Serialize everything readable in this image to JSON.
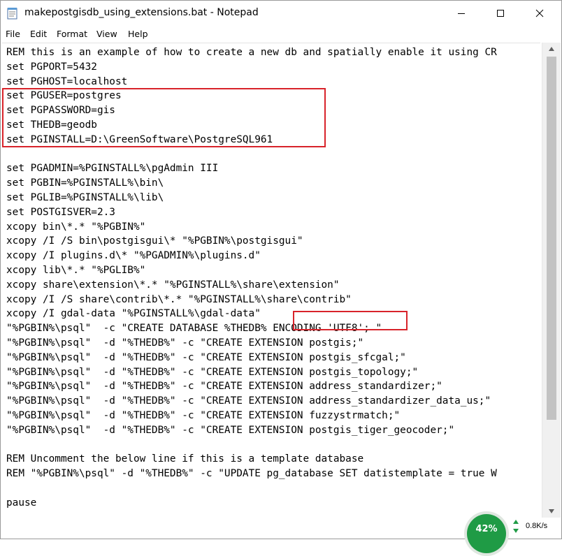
{
  "window": {
    "title": "makepostgisdb_using_extensions.bat - Notepad"
  },
  "menu": [
    "File",
    "Edit",
    "Format",
    "View",
    "Help"
  ],
  "editor": {
    "lines": [
      "REM this is an example of how to create a new db and spatially enable it using CR",
      "set PGPORT=5432",
      "set PGHOST=localhost",
      "set PGUSER=postgres",
      "set PGPASSWORD=gis",
      "set THEDB=geodb",
      "set PGINSTALL=D:\\GreenSoftware\\PostgreSQL961",
      "",
      "set PGADMIN=%PGINSTALL%\\pgAdmin III",
      "set PGBIN=%PGINSTALL%\\bin\\",
      "set PGLIB=%PGINSTALL%\\lib\\",
      "set POSTGISVER=2.3",
      "xcopy bin\\*.* \"%PGBIN%\"",
      "xcopy /I /S bin\\postgisgui\\* \"%PGBIN%\\postgisgui\"",
      "xcopy /I plugins.d\\* \"%PGADMIN%\\plugins.d\"",
      "xcopy lib\\*.* \"%PGLIB%\"",
      "xcopy share\\extension\\*.* \"%PGINSTALL%\\share\\extension\"",
      "xcopy /I /S share\\contrib\\*.* \"%PGINSTALL%\\share\\contrib\"",
      "xcopy /I gdal-data \"%PGINSTALL%\\gdal-data\"",
      "\"%PGBIN%\\psql\"  -c \"CREATE DATABASE %THEDB% ENCODING 'UTF8'; \"",
      "\"%PGBIN%\\psql\"  -d \"%THEDB%\" -c \"CREATE EXTENSION postgis;\"",
      "\"%PGBIN%\\psql\"  -d \"%THEDB%\" -c \"CREATE EXTENSION postgis_sfcgal;\"",
      "\"%PGBIN%\\psql\"  -d \"%THEDB%\" -c \"CREATE EXTENSION postgis_topology;\"",
      "\"%PGBIN%\\psql\"  -d \"%THEDB%\" -c \"CREATE EXTENSION address_standardizer;\"",
      "\"%PGBIN%\\psql\"  -d \"%THEDB%\" -c \"CREATE EXTENSION address_standardizer_data_us;\"",
      "\"%PGBIN%\\psql\"  -d \"%THEDB%\" -c \"CREATE EXTENSION fuzzystrmatch;\"",
      "\"%PGBIN%\\psql\"  -d \"%THEDB%\" -c \"CREATE EXTENSION postgis_tiger_geocoder;\"",
      "",
      "REM Uncomment the below line if this is a template database",
      "REM \"%PGBIN%\\psql\" -d \"%THEDB%\" -c \"UPDATE pg_database SET datistemplate = true W",
      "",
      "pause"
    ]
  },
  "overlay": {
    "percent": "42%",
    "speed": "0.8K/s"
  },
  "colors": {
    "highlight": "#d8232a",
    "badge": "#1f9b45"
  }
}
